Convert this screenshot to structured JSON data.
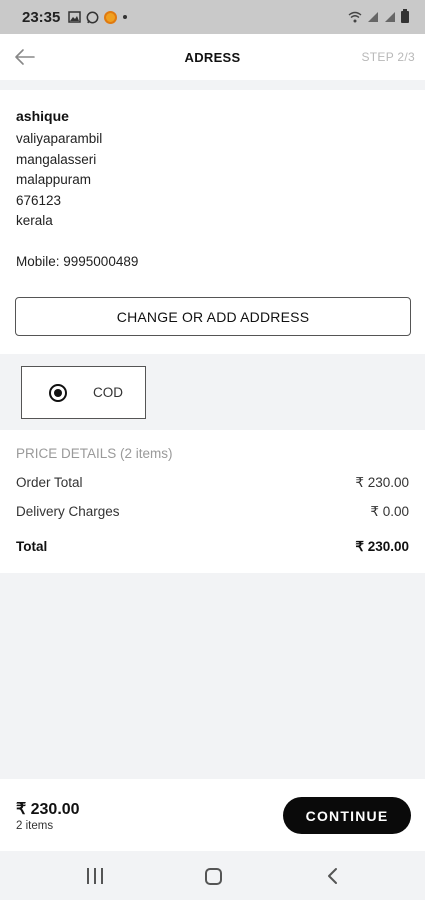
{
  "status": {
    "time": "23:35",
    "icons": [
      "gallery-icon",
      "whatsapp-icon",
      "coin-icon",
      "dot-icon"
    ],
    "right_icons": [
      "wifi-icon",
      "signal-icon",
      "signal-icon",
      "battery-icon"
    ]
  },
  "appbar": {
    "title": "ADRESS",
    "step": "STEP 2/3"
  },
  "address": {
    "name": "ashique",
    "lines": [
      "valiyaparambil",
      "mangalasseri",
      "malappuram",
      "676123",
      "kerala"
    ],
    "mobile": "Mobile: 9995000489",
    "change_button": "CHANGE OR ADD ADDRESS"
  },
  "payment": {
    "options": [
      {
        "label": "COD",
        "selected": true
      }
    ]
  },
  "price": {
    "header": "PRICE DETAILS (2 items)",
    "rows": [
      {
        "label": "Order Total",
        "value": "₹ 230.00"
      },
      {
        "label": "Delivery Charges",
        "value": "₹ 0.00"
      }
    ],
    "total": {
      "label": "Total",
      "value": "₹ 230.00"
    }
  },
  "bottom": {
    "amount": "₹ 230.00",
    "items": "2 items",
    "continue_label": "CONTINUE"
  },
  "colors": {
    "background": "#f2f3f5",
    "card": "#ffffff",
    "primary_button": "#0a0a0a",
    "muted_text": "#9a9a9a"
  }
}
